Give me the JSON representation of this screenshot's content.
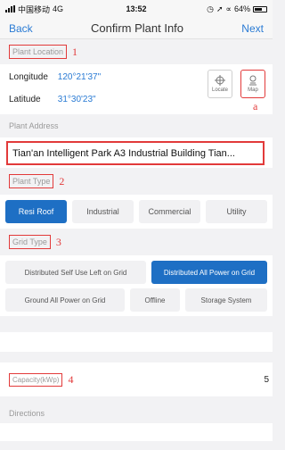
{
  "status_bar": {
    "carrier": "中国移动",
    "network": "4G",
    "time": "13:52",
    "battery": "64%"
  },
  "nav": {
    "back_label": "Back",
    "title": "Confirm Plant Info",
    "next_label": "Next"
  },
  "plant_location": {
    "header": "Plant Location",
    "annotation": "1",
    "longitude_label": "Longitude",
    "longitude_value": "120°21'37\"",
    "latitude_label": "Latitude",
    "latitude_value": "31°30'23\"",
    "locate_label": "Locate",
    "map_label": "Map",
    "map_annotation": "a"
  },
  "plant_address": {
    "header": "Plant Address",
    "value": "Tian'an Intelligent Park A3 Industrial Building Tian..."
  },
  "plant_type": {
    "header": "Plant Type",
    "annotation": "2",
    "options": [
      "Resi Roof",
      "Industrial",
      "Commercial",
      "Utility"
    ],
    "selected": "Resi Roof"
  },
  "grid_type": {
    "header": "Grid Type",
    "annotation": "3",
    "row1": [
      "Distributed Self Use Left on Grid",
      "Distributed All Power on Grid"
    ],
    "row2": [
      "Ground All Power on Grid",
      "Offline",
      "Storage System"
    ],
    "selected": "Distributed All Power on Grid"
  },
  "capacity": {
    "label": "Capacity(kWp)",
    "annotation": "4",
    "value": "5"
  },
  "directions": {
    "header": "Directions"
  },
  "colors": {
    "accent": "#1e6fc4",
    "link": "#2a7bd4",
    "annotation": "#e23a3a"
  }
}
